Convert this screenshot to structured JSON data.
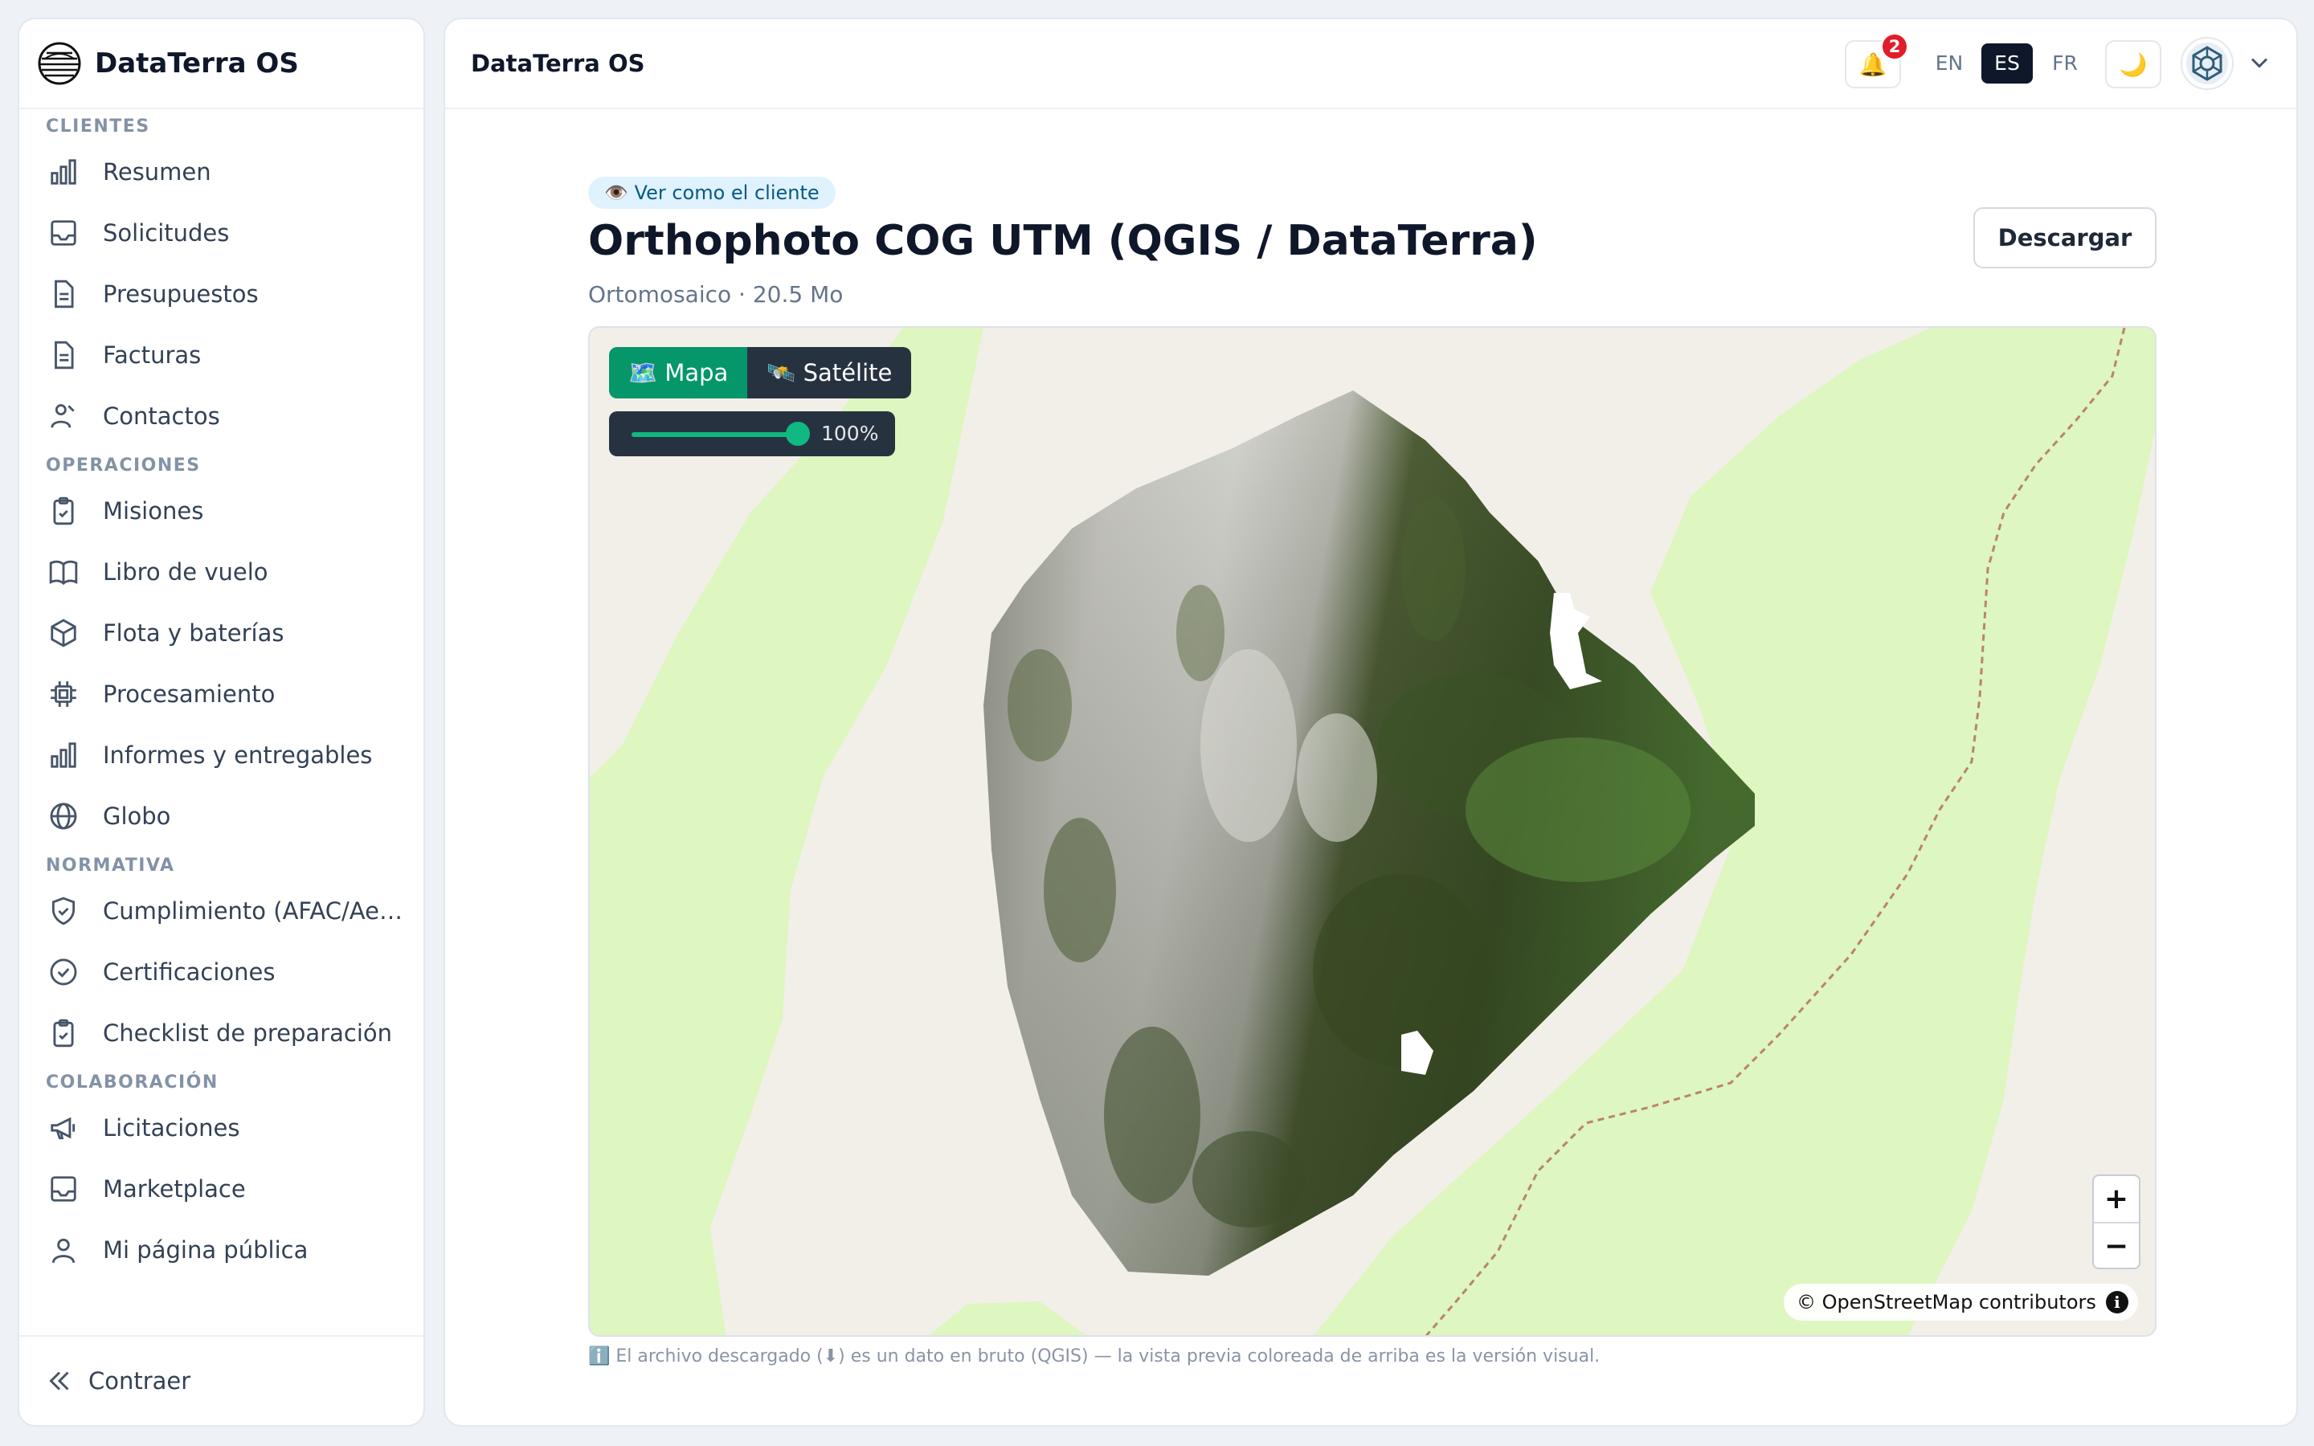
{
  "brand": {
    "name": "DataTerra OS"
  },
  "sidebar": {
    "sections": [
      {
        "title": "CLIENTES",
        "items": [
          {
            "label": "Resumen",
            "icon": "bar-chart-icon"
          },
          {
            "label": "Solicitudes",
            "icon": "inbox-icon"
          },
          {
            "label": "Presupuestos",
            "icon": "document-icon"
          },
          {
            "label": "Facturas",
            "icon": "document-icon"
          },
          {
            "label": "Contactos",
            "icon": "contacts-icon"
          }
        ]
      },
      {
        "title": "OPERACIONES",
        "items": [
          {
            "label": "Misiones",
            "icon": "clipboard-check-icon"
          },
          {
            "label": "Libro de vuelo",
            "icon": "book-icon"
          },
          {
            "label": "Flota y baterías",
            "icon": "cube-icon"
          },
          {
            "label": "Procesamiento",
            "icon": "cpu-icon"
          },
          {
            "label": "Informes y entregables",
            "icon": "bar-chart-icon"
          },
          {
            "label": "Globo",
            "icon": "globe-icon"
          }
        ]
      },
      {
        "title": "NORMATIVA",
        "items": [
          {
            "label": "Cumplimiento (AFAC/Aer...",
            "icon": "shield-check-icon"
          },
          {
            "label": "Certificaciones",
            "icon": "check-circle-icon"
          },
          {
            "label": "Checklist de preparación",
            "icon": "clipboard-check-icon"
          }
        ]
      },
      {
        "title": "COLABORACIÓN",
        "items": [
          {
            "label": "Licitaciones",
            "icon": "megaphone-icon"
          },
          {
            "label": "Marketplace",
            "icon": "inbox-icon"
          },
          {
            "label": "Mi página pública",
            "icon": "user-icon"
          }
        ]
      }
    ],
    "collapse_label": "Contraer"
  },
  "topbar": {
    "title": "DataTerra OS",
    "notifications_count": "2",
    "bell_glyph": "🔔",
    "languages": [
      "EN",
      "ES",
      "FR"
    ],
    "active_language": "ES",
    "theme_glyph": "🌙"
  },
  "content": {
    "view_as_client": "👁️ Ver como el cliente",
    "title": "Orthophoto COG UTM (QGIS / DataTerra)",
    "subtitle": "Ortomosaico · 20.5 Mo",
    "download_label": "Descargar",
    "map": {
      "mode_map": "🗺️ Mapa",
      "mode_satellite": "🛰️ Satélite",
      "active_mode": "map",
      "opacity": "100%",
      "opacity_value": 1.0,
      "zoom_in": "+",
      "zoom_out": "−",
      "attribution": "© OpenStreetMap contributors",
      "attribution_info": "i"
    },
    "footnote": "ℹ️ El archivo descargado (⬇) es un dato en bruto (QGIS) — la vista previa coloreada de arriba es la versión visual."
  },
  "colors": {
    "accent": "#059669",
    "active_lang_bg": "#0f172a",
    "badge": "#e11d2a",
    "map_land": "#f2efe9",
    "map_green": "#def6c0",
    "path": "#b9846b"
  }
}
